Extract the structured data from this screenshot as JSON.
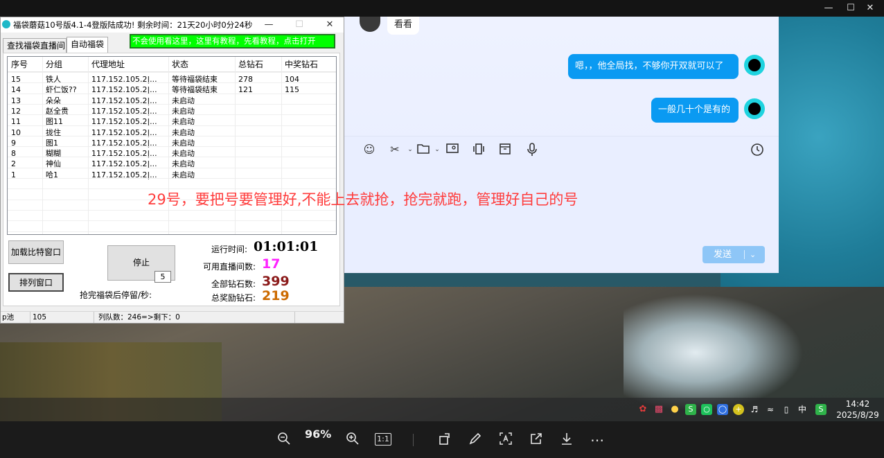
{
  "viewer": {
    "zoom": "96%",
    "ratio_button": "1:1",
    "window_controls": [
      "minimize-icon",
      "maximize-icon",
      "close-icon"
    ]
  },
  "chat": {
    "incoming_message": "看看",
    "outgoing_messages": [
      "嗯，，他全局找，不够你开双就可以了",
      "一般几十个是有的"
    ],
    "toolbar_icons": [
      "emoji-icon",
      "scissors-icon",
      "folder-icon",
      "image-icon",
      "video-icon",
      "box-icon",
      "microphone-icon",
      "history-icon"
    ],
    "send_label": "发送"
  },
  "app": {
    "title": "福袋蘑菇10号版4.1-4登版陆成功! 剩余时间：21天20小时0分24秒",
    "help_banner": "不会使用看这里，这里有教程，先看教程，点击打开",
    "tabs": [
      "查找福袋直播间",
      "自动福袋"
    ],
    "columns": [
      "序号",
      "分组",
      "代理地址",
      "状态",
      "总钻石",
      "中奖钻石"
    ],
    "rows": [
      [
        "15",
        "铁人",
        "117.152.105.2|...",
        "等待福袋结束",
        "278",
        "104"
      ],
      [
        "14",
        "虾仁饭??",
        "117.152.105.2|...",
        "等待福袋结束",
        "121",
        "115"
      ],
      [
        "13",
        "朵朵",
        "117.152.105.2|...",
        "未启动",
        "",
        ""
      ],
      [
        "12",
        "赵全贵",
        "117.152.105.2|...",
        "未启动",
        "",
        ""
      ],
      [
        "11",
        "图11",
        "117.152.105.2|...",
        "未启动",
        "",
        ""
      ],
      [
        "10",
        "拢住",
        "117.152.105.2|...",
        "未启动",
        "",
        ""
      ],
      [
        "9",
        "图1",
        "117.152.105.2|...",
        "未启动",
        "",
        ""
      ],
      [
        "8",
        "糊糊",
        "117.152.105.2|...",
        "未启动",
        "",
        ""
      ],
      [
        "2",
        "神仙",
        "117.152.105.2|...",
        "未启动",
        "",
        ""
      ],
      [
        "1",
        "哈1",
        "117.152.105.2|...",
        "未启动",
        "",
        ""
      ]
    ],
    "buttons": {
      "load": "加载比特窗口",
      "arrange": "排列窗口",
      "stop": "停止"
    },
    "stay_label": "抢完福袋后停留/秒:",
    "stay_value": "5",
    "stats": {
      "runtime_label": "运行时间:",
      "runtime_value": "01:01:01",
      "rooms_label": "可用直播间数:",
      "rooms_value": "17",
      "total_label": "全部钻石数:",
      "total_value": "399",
      "prize_label": "总奖励钻石:",
      "prize_value": "219"
    },
    "status": {
      "pool_label": "p池",
      "pool_value": "105",
      "queue": "列队数：246=>剩下：0"
    }
  },
  "overlay_caption": "29号，要把号要管理好,不能上去就抢，抢完就跑，管理好自己的号",
  "taskbar": {
    "ime": "中",
    "time": "14:42",
    "date": "2025/8/29"
  },
  "colors": {
    "rooms_value": "#ff22ff",
    "total_value": "#8b1a1a",
    "prize_value": "#cc6a00",
    "overlay": "#ff3b3b",
    "chat_bubble": "#0a9af2",
    "help_banner": "#00ff00"
  }
}
